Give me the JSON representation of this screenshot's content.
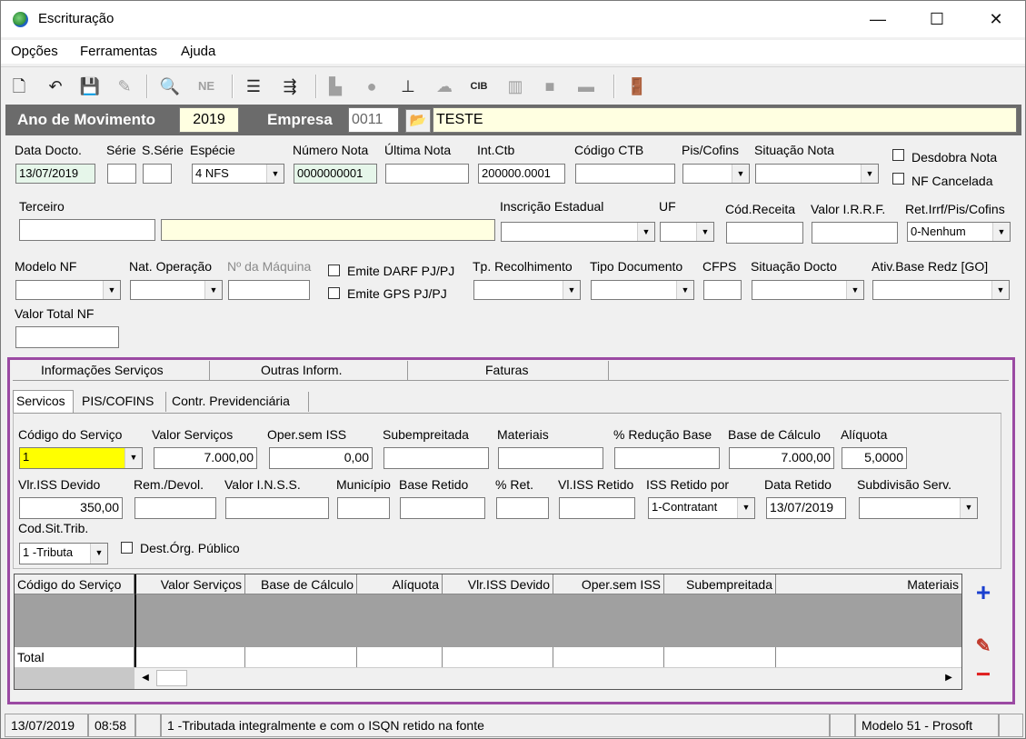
{
  "window": {
    "title": "Escrituração",
    "minimize": "—",
    "maximize": "☐",
    "close": "✕"
  },
  "menu": [
    "Opções",
    "Ferramentas",
    "Ajuda"
  ],
  "toolbar_icons": [
    "new-document-icon",
    "undo-icon",
    "save-icon",
    "delete-icon",
    "print-preview-icon",
    "nfe-icon",
    "tree-list-icon",
    "export-icon",
    "folder-icon",
    "apple-icon",
    "stamp-icon",
    "cloud-icon",
    "cib-icon",
    "columns-icon",
    "square-icon",
    "minus-icon",
    "exit-door-icon"
  ],
  "header": {
    "ano_label": "Ano de Movimento",
    "ano_value": "2019",
    "empresa_label": "Empresa",
    "empresa_code": "0011",
    "empresa_name": "TESTE"
  },
  "labels": {
    "data_docto": "Data Docto.",
    "serie": "Série",
    "sserie": "S.Série",
    "especie": "Espécie",
    "numero_nota": "Número Nota",
    "ultima_nota": "Última Nota",
    "int_ctb": "Int.Ctb",
    "codigo_ctb": "Código CTB",
    "pis_cofins": "Pis/Cofins",
    "situacao_nota": "Situação Nota",
    "desdobra_nota": "Desdobra Nota",
    "nf_cancelada": "NF Cancelada",
    "terceiro": "Terceiro",
    "inscricao_estadual": "Inscrição Estadual",
    "uf": "UF",
    "cod_receita": "Cód.Receita",
    "valor_irrf": "Valor I.R.R.F.",
    "ret_irrf": "Ret.Irrf/Pis/Cofins",
    "modelo_nf": "Modelo NF",
    "nat_operacao": "Nat. Operação",
    "num_maquina": "Nº da Máquina",
    "emite_darf": "Emite DARF PJ/PJ",
    "emite_gps": "Emite GPS PJ/PJ",
    "tp_recolhimento": "Tp. Recolhimento",
    "tipo_documento": "Tipo Documento",
    "cfps": "CFPS",
    "situacao_docto": "Situação Docto",
    "ativ_base": "Ativ.Base Redz [GO]",
    "valor_total_nf": "Valor Total NF"
  },
  "values": {
    "data_docto": "13/07/2019",
    "especie": "4 NFS",
    "numero_nota": "0000000001",
    "int_ctb": "200000.0001",
    "ret_irrf": "0-Nenhum"
  },
  "tabs_main": [
    "Informações Serviços",
    "Outras Inform.",
    "Faturas"
  ],
  "tabs_sub": [
    "Servicos",
    "PIS/COFINS",
    "Contr. Previdenciária"
  ],
  "serv_labels": {
    "codigo_servico": "Código do Serviço",
    "valor_servicos": "Valor Serviços",
    "oper_sem_iss": "Oper.sem ISS",
    "subempreitada": "Subempreitada",
    "materiais": "Materiais",
    "reducao_base": "% Redução Base",
    "base_calculo": "Base de Cálculo",
    "aliquota": "Alíquota",
    "vlr_iss_devido": "Vlr.ISS Devido",
    "rem_devol": "Rem./Devol.",
    "valor_inss": "Valor I.N.S.S.",
    "municipio": "Município",
    "base_retido": "Base Retido",
    "pct_ret": "% Ret.",
    "vl_iss_retido": "Vl.ISS Retido",
    "iss_retido_por": "ISS Retido por",
    "data_retido": "Data Retido",
    "subdivisao": "Subdivisão Serv.",
    "cod_sit_trib": "Cod.Sit.Trib.",
    "dest_org": "Dest.Órg. Público"
  },
  "serv_values": {
    "codigo_servico": "1",
    "valor_servicos": "7.000,00",
    "oper_sem_iss": "0,00",
    "base_calculo": "7.000,00",
    "aliquota": "5,0000",
    "vlr_iss_devido": "350,00",
    "iss_retido_por": "1-Contratant",
    "data_retido": "13/07/2019",
    "cod_sit_trib": "1 -Tributa"
  },
  "grid": {
    "columns": [
      "Código do Serviço",
      "Valor Serviços",
      "Base de Cálculo",
      "Alíquota",
      "Vlr.ISS Devido",
      "Oper.sem ISS",
      "Subempreitada",
      "Materiais"
    ],
    "total_label": "Total"
  },
  "status": {
    "date": "13/07/2019",
    "time": "08:58",
    "message": "1 -Tributada integralmente e com o ISQN retido na fonte",
    "model": "Modelo 51 - Prosoft"
  },
  "colors": {
    "accent_border": "#9b4aa3",
    "dark_bar": "#6b6b6b",
    "highlight": "#ffff00"
  }
}
